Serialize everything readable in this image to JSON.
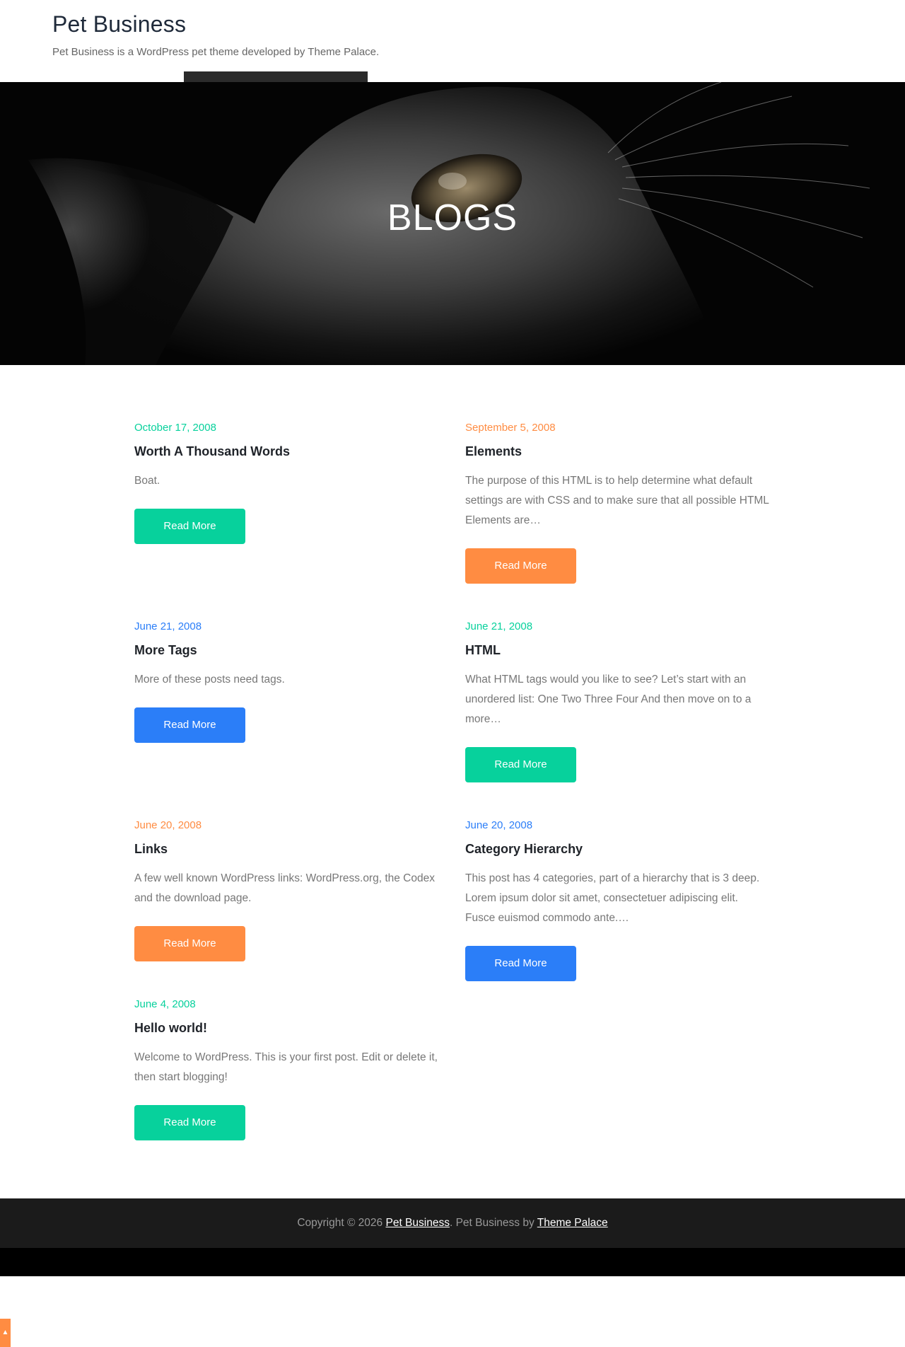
{
  "header": {
    "site_title": "Pet Business",
    "site_description": "Pet Business is a WordPress pet theme developed by Theme Palace."
  },
  "hero": {
    "title": "BLOGS"
  },
  "posts": [
    {
      "date": "October 17, 2008",
      "title": "Worth A Thousand Words",
      "excerpt": "Boat.",
      "read_more": "Read More",
      "accent": "#07d19c"
    },
    {
      "date": "September 5, 2008",
      "title": "Elements",
      "excerpt": "The purpose of this HTML is to help determine what default settings are with CSS and to make sure that all possible HTML Elements are…",
      "read_more": "Read More",
      "accent": "#ff8c42"
    },
    {
      "date": "June 21, 2008",
      "title": "More Tags",
      "excerpt": "More of these posts need tags.",
      "read_more": "Read More",
      "accent": "#2b7ef8"
    },
    {
      "date": "June 21, 2008",
      "title": "HTML",
      "excerpt": "What HTML tags would you like to see? Let’s start with an unordered list: One Two Three Four And then move on to a more…",
      "read_more": "Read More",
      "accent": "#07d19c"
    },
    {
      "date": "June 20, 2008",
      "title": "Links",
      "excerpt": "A few well known WordPress links: WordPress.org, the Codex and the download page.",
      "read_more": "Read More",
      "accent": "#ff8c42"
    },
    {
      "date": "June 20, 2008",
      "title": "Category Hierarchy",
      "excerpt": "This post has 4 categories, part of a hierarchy that is 3 deep. Lorem ipsum dolor sit amet, consectetuer adipiscing elit. Fusce euismod commodo ante.…",
      "read_more": "Read More",
      "accent": "#2b7ef8"
    },
    {
      "date": "June 4, 2008",
      "title": "Hello world!",
      "excerpt": "Welcome to WordPress. This is your first post. Edit or delete it, then start blogging!",
      "read_more": "Read More",
      "accent": "#07d19c"
    }
  ],
  "footer": {
    "copyright_prefix": "Copyright © 2026 ",
    "site_link": "Pet Business",
    "middle_text": ". Pet Business by ",
    "theme_link": "Theme Palace"
  },
  "back_to_top": {
    "icon": "chevron-up-icon"
  }
}
